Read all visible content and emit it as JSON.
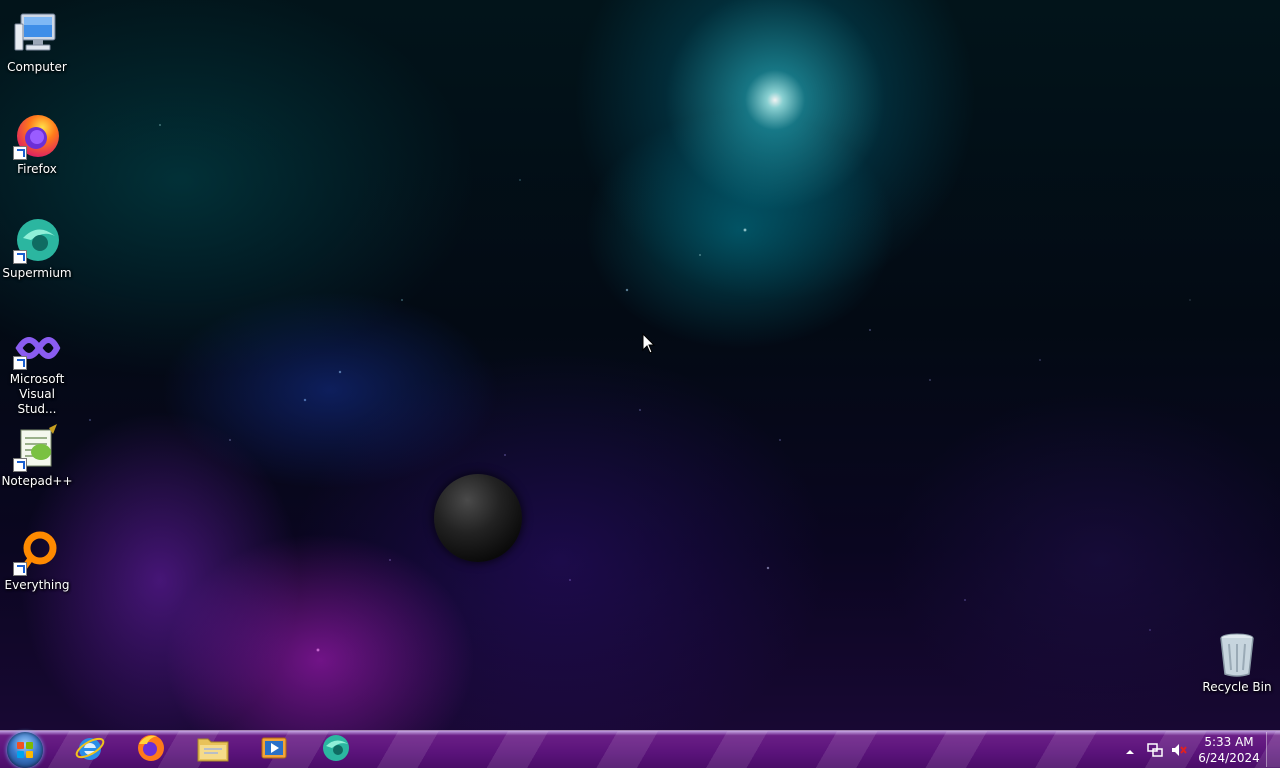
{
  "desktop": {
    "icons": [
      {
        "label": "Computer",
        "icon": "computer-icon"
      },
      {
        "label": "Firefox",
        "icon": "firefox-icon"
      },
      {
        "label": "Supermium",
        "icon": "supermium-icon"
      },
      {
        "label": "Microsoft Visual Stud...",
        "icon": "visual-studio-icon"
      },
      {
        "label": "Notepad++",
        "icon": "notepadpp-icon"
      },
      {
        "label": "Everything",
        "icon": "everything-icon"
      },
      {
        "label": "Recycle Bin",
        "icon": "recycle-bin-icon"
      }
    ]
  },
  "taskbar": {
    "pinned": [
      {
        "name": "Internet Explorer",
        "icon": "internet-explorer-icon"
      },
      {
        "name": "Firefox",
        "icon": "firefox-icon"
      },
      {
        "name": "File Explorer",
        "icon": "folder-icon"
      },
      {
        "name": "Media Player",
        "icon": "media-player-icon"
      },
      {
        "name": "Supermium",
        "icon": "supermium-icon"
      }
    ],
    "tray": {
      "time": "5:33 AM",
      "date": "6/24/2024"
    }
  },
  "colors": {
    "taskbar": "#5a137a",
    "desktop_dark": "#030a14"
  }
}
